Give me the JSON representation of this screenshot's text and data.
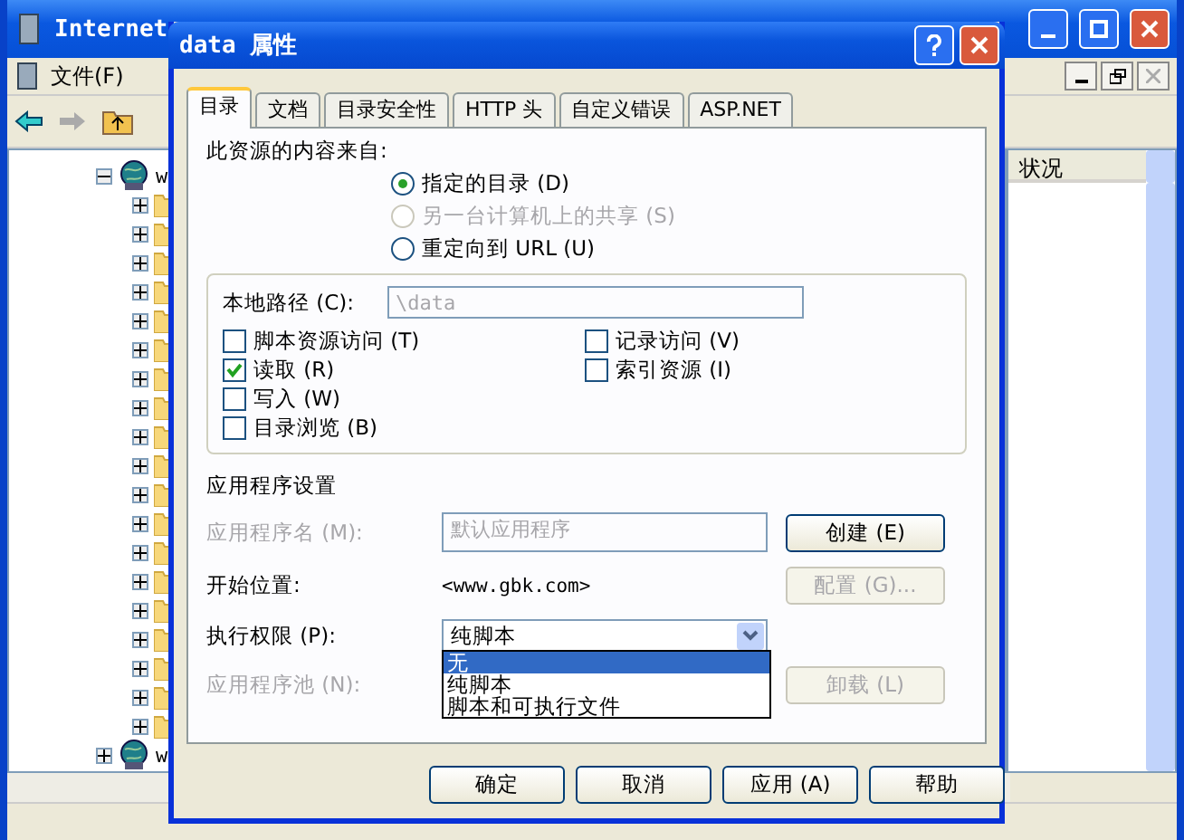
{
  "background_window": {
    "title": "Internet",
    "menu": [
      "文件(F)"
    ],
    "tree": [
      {
        "label": "w",
        "expanded": true,
        "children": [
          {
            "expanded": false
          },
          {
            "expanded": false
          },
          {
            "expanded": false
          },
          {
            "expanded": false
          },
          {
            "expanded": false
          },
          {
            "expanded": false
          },
          {
            "expanded": false
          },
          {
            "expanded": false
          },
          {
            "expanded": false
          },
          {
            "expanded": false
          },
          {
            "expanded": false
          },
          {
            "expanded": false
          },
          {
            "expanded": false
          },
          {
            "expanded": false
          },
          {
            "expanded": false
          },
          {
            "expanded": false
          },
          {
            "expanded": false
          },
          {
            "expanded": false
          },
          {
            "expanded": false
          }
        ]
      },
      {
        "label": "w",
        "expanded": false
      }
    ],
    "list_columns": [
      "状况"
    ]
  },
  "dialog": {
    "title": "data 属性",
    "tabs": [
      {
        "label": "目录",
        "selected": true
      },
      {
        "label": "文档",
        "selected": false
      },
      {
        "label": "目录安全性",
        "selected": false
      },
      {
        "label": "HTTP 头",
        "selected": false
      },
      {
        "label": "自定义错误",
        "selected": false
      },
      {
        "label": "ASP.NET",
        "selected": false
      }
    ],
    "source_label": "此资源的内容来自:",
    "source_options": [
      {
        "label": "指定的目录 (D)",
        "selected": true,
        "disabled": false
      },
      {
        "label": "另一台计算机上的共享 (S)",
        "selected": false,
        "disabled": true
      },
      {
        "label": "重定向到 URL (U)",
        "selected": false,
        "disabled": false
      }
    ],
    "local_path": {
      "label": "本地路径 (C):",
      "value": "\\data",
      "disabled": true
    },
    "permissions": [
      {
        "label": "脚本资源访问 (T)",
        "checked": false
      },
      {
        "label": "读取 (R)",
        "checked": true
      },
      {
        "label": "写入 (W)",
        "checked": false
      },
      {
        "label": "目录浏览 (B)",
        "checked": false
      },
      {
        "label": "记录访问 (V)",
        "checked": false
      },
      {
        "label": "索引资源 (I)",
        "checked": false
      }
    ],
    "app_settings_heading": "应用程序设置",
    "app_name": {
      "label": "应用程序名 (M):",
      "value": "默认应用程序",
      "disabled": true,
      "button": {
        "label": "创建 (E)",
        "disabled": false
      }
    },
    "start_location": {
      "label": "开始位置:",
      "value": "<www.gbk.com>",
      "button": {
        "label": "配置 (G)...",
        "disabled": true
      }
    },
    "execute_permissions": {
      "label": "执行权限 (P):",
      "value": "纯脚本",
      "expanded": true,
      "options": [
        {
          "label": "无",
          "highlighted": true
        },
        {
          "label": "纯脚本",
          "highlighted": false
        },
        {
          "label": "脚本和可执行文件",
          "highlighted": false
        }
      ]
    },
    "app_pool": {
      "label": "应用程序池 (N):",
      "disabled": true,
      "button": {
        "label": "卸载 (L)",
        "disabled": true
      }
    },
    "buttons": [
      "确定",
      "取消",
      "应用 (A)",
      "帮助"
    ]
  }
}
